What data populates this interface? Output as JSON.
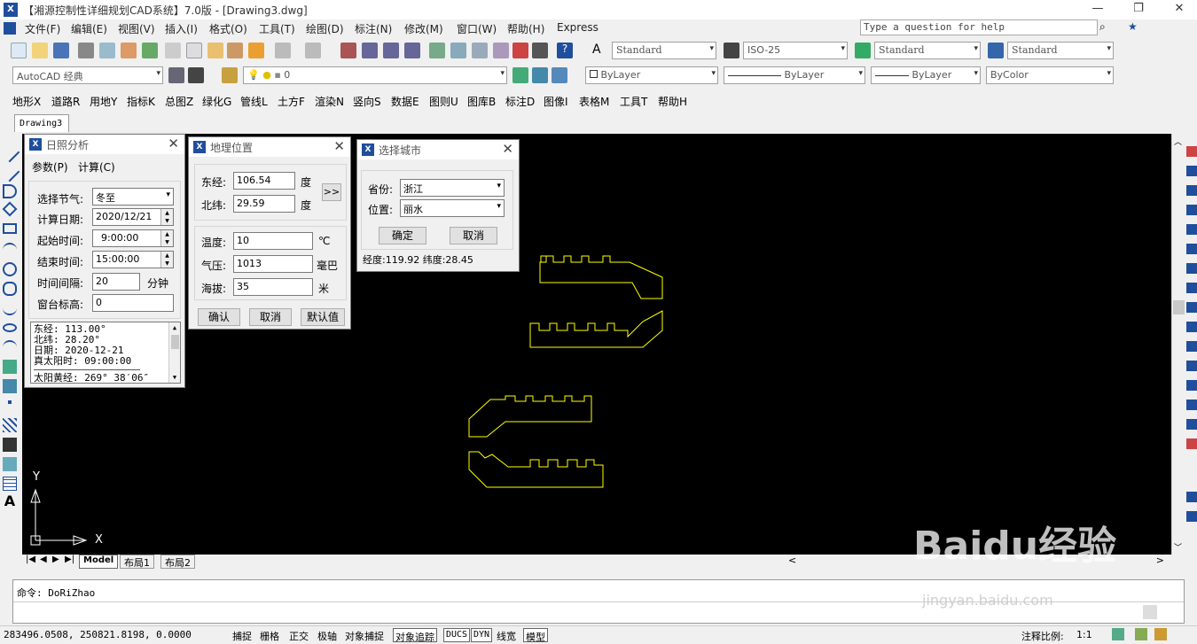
{
  "window": {
    "title": "【湘源控制性详细规划CAD系统】7.0版 - [Drawing3.dwg]",
    "logo": "X",
    "min_glyph": "—",
    "restore_glyph": "❐",
    "close_glyph": "✕"
  },
  "menu": {
    "items": [
      "文件(F)",
      "编辑(E)",
      "视图(V)",
      "插入(I)",
      "格式(O)",
      "工具(T)",
      "绘图(D)",
      "标注(N)",
      "修改(M)",
      "窗口(W)",
      "帮助(H)",
      "Express"
    ],
    "help_placeholder": "Type a question for help"
  },
  "toolbar_styles": {
    "text_style": "Standard",
    "dim_style": "ISO-25",
    "table_style": "Standard",
    "multileader_style": "Standard"
  },
  "toolbar_layers": {
    "workspace": "AutoCAD 经典",
    "layer": "0",
    "color": "ByLayer",
    "linetype": "ByLayer",
    "lineweight": "ByLayer",
    "plotstyle": "ByColor"
  },
  "custom_menu": [
    "地形X",
    "道路R",
    "用地Y",
    "指标K",
    "总图Z",
    "绿化G",
    "管线L",
    "土方F",
    "渲染N",
    "竖向S",
    "数据E",
    "图则U",
    "图库B",
    "标注D",
    "图像I",
    "表格M",
    "工具T",
    "帮助H"
  ],
  "drawing_tab": "Drawing3",
  "dialog_sunlight": {
    "title": "日照分析",
    "tab_params": "参数(P)",
    "tab_calc": "计算(C)",
    "season_label": "选择节气:",
    "season_value": "冬至",
    "date_label": "计算日期:",
    "date_value": "2020/12/21",
    "start_label": "起始时间:",
    "start_value": "9:00:00",
    "end_label": "结束时间:",
    "end_value": "15:00:00",
    "interval_label": "时间间隔:",
    "interval_value": "20",
    "interval_unit": "分钟",
    "sill_label": "窗台标高:",
    "sill_value": "0",
    "info_lines": [
      "东经: 113.00°",
      "北纬: 28.20°",
      "日期: 2020-12-21",
      "真太阳时: 09:00:00",
      "",
      "太阳黄经: 269° 38′06″"
    ]
  },
  "dialog_geo": {
    "title": "地理位置",
    "lon_label": "东经:",
    "lon_value": "106.54",
    "lon_unit": "度",
    "lat_label": "北纬:",
    "lat_value": "29.59",
    "lat_unit": "度",
    "more_button": ">>",
    "temp_label": "温度:",
    "temp_value": "10",
    "temp_unit": "℃",
    "pressure_label": "气压:",
    "pressure_value": "1013",
    "pressure_unit": "毫巴",
    "alt_label": "海拔:",
    "alt_value": "35",
    "alt_unit": "米",
    "ok": "确认",
    "cancel": "取消",
    "default": "默认值"
  },
  "dialog_city": {
    "title": "选择城市",
    "province_label": "省份:",
    "province_value": "浙江",
    "city_label": "位置:",
    "city_value": "丽水",
    "ok": "确定",
    "cancel": "取消",
    "status": "经度:119.92  纬度:28.45"
  },
  "canvas": {
    "ucs_x": "X",
    "ucs_y": "Y",
    "shape_color": "#ffff00",
    "background": "#000000"
  },
  "layout_tabs": [
    "Model",
    "布局1",
    "布局2"
  ],
  "command": {
    "line": "命令: DoRiZhao"
  },
  "status": {
    "coords": "283496.0508, 250821.8198, 0.0000",
    "toggles": [
      "捕捉",
      "栅格",
      "正交",
      "极轴",
      "对象捕捉",
      "对象追踪",
      "DUCS",
      "DYN",
      "线宽",
      "模型"
    ],
    "scale_label": "注释比例:",
    "scale_value": "1:1"
  },
  "watermark": {
    "brand": "Baidu经验",
    "url": "jingyan.baidu.com"
  }
}
